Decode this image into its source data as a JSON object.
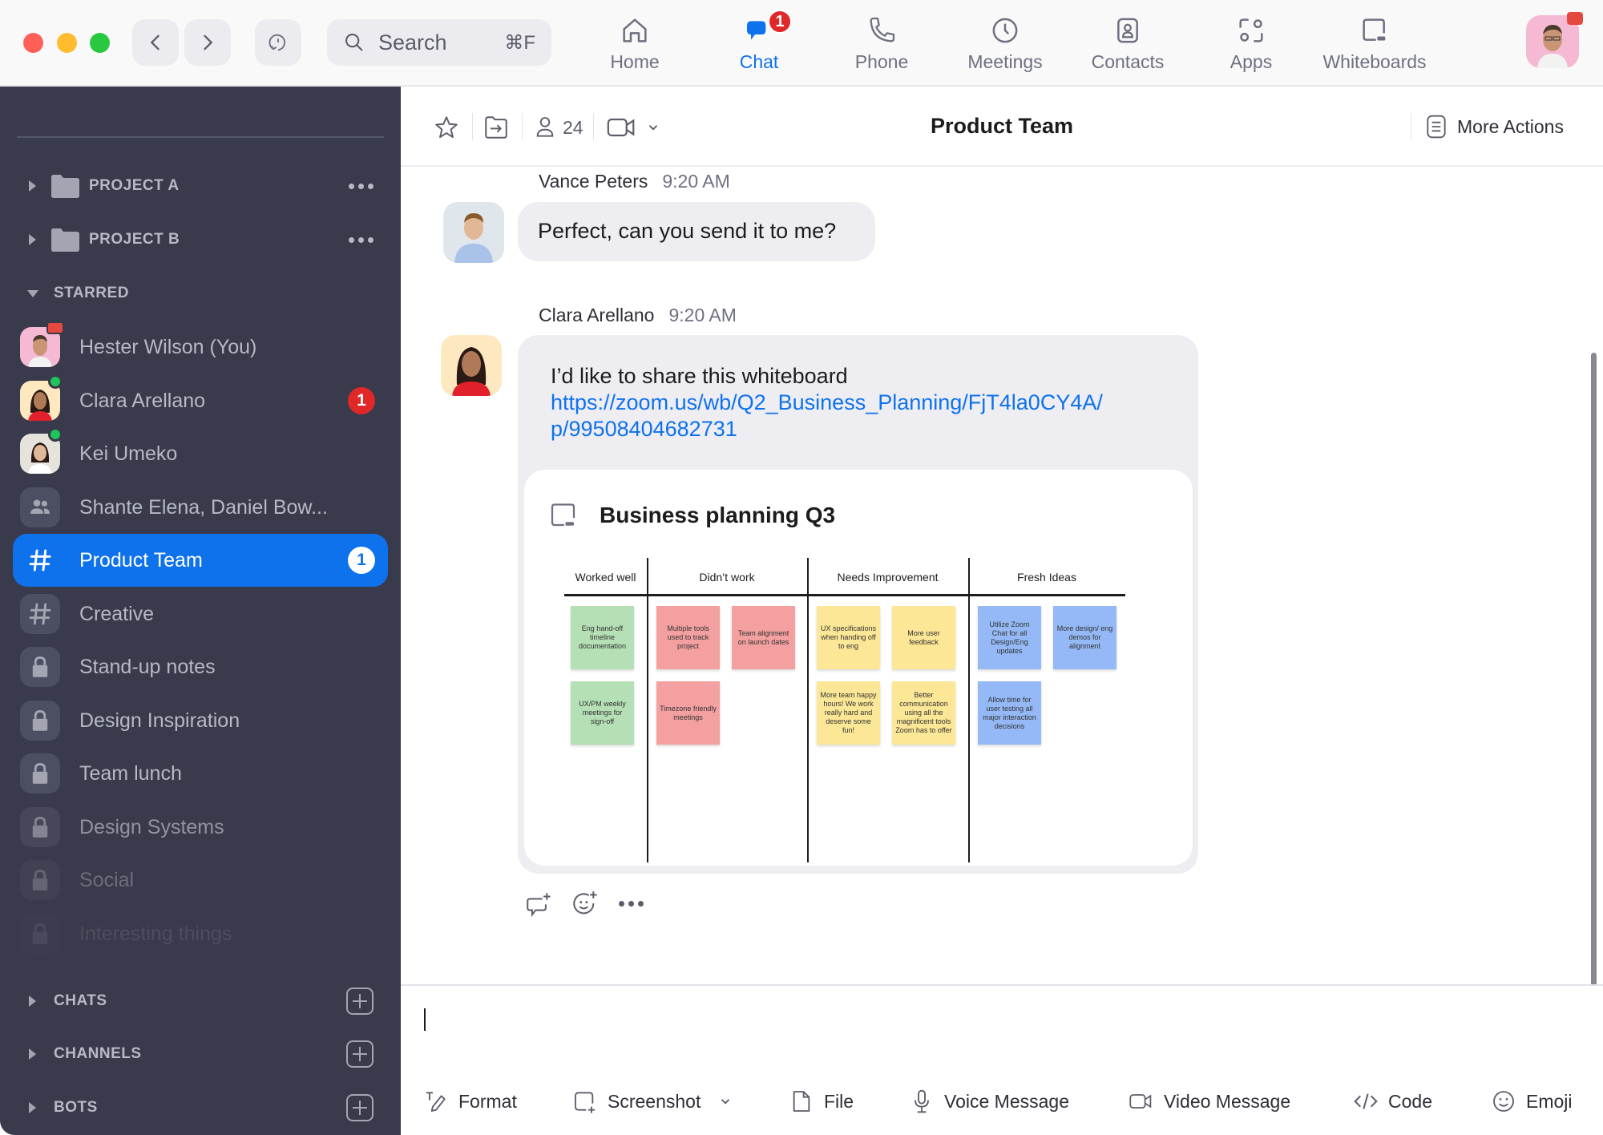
{
  "titlebar": {
    "search_label": "Search",
    "search_shortcut": "⌘F",
    "nav": [
      {
        "label": "Home",
        "icon": "home-icon",
        "active": false
      },
      {
        "label": "Chat",
        "icon": "chat-icon",
        "active": true,
        "badge": "1"
      },
      {
        "label": "Phone",
        "icon": "phone-icon",
        "active": false
      },
      {
        "label": "Meetings",
        "icon": "clock-icon",
        "active": false
      },
      {
        "label": "Contacts",
        "icon": "contacts-icon",
        "active": false
      },
      {
        "label": "Apps",
        "icon": "apps-icon",
        "active": false
      },
      {
        "label": "Whiteboards",
        "icon": "whiteboard-icon",
        "active": false
      }
    ]
  },
  "sidebar": {
    "folders": [
      {
        "label": "PROJECT A"
      },
      {
        "label": "PROJECT B"
      }
    ],
    "starred_label": "STARRED",
    "items": [
      {
        "label": "Hester Wilson (You)",
        "type": "avatar",
        "status": "in-meeting"
      },
      {
        "label": "Clara Arellano",
        "type": "avatar",
        "status": "online",
        "badge": "1"
      },
      {
        "label": "Kei Umeko",
        "type": "avatar",
        "status": "online"
      },
      {
        "label": "Shante Elena, Daniel Bow...",
        "type": "group"
      },
      {
        "label": "Product Team",
        "type": "channel",
        "badge": "1",
        "active": true
      },
      {
        "label": "Creative",
        "type": "channel"
      },
      {
        "label": "Stand-up notes",
        "type": "private"
      },
      {
        "label": "Design Inspiration",
        "type": "private"
      },
      {
        "label": "Team lunch",
        "type": "private"
      },
      {
        "label": "Design Systems",
        "type": "private"
      },
      {
        "label": "Social",
        "type": "private"
      },
      {
        "label": "Interesting things",
        "type": "private"
      }
    ],
    "sections": [
      {
        "label": "CHATS"
      },
      {
        "label": "CHANNELS"
      },
      {
        "label": "BOTS"
      }
    ]
  },
  "chat_header": {
    "title": "Product Team",
    "member_count": "24",
    "more_actions_label": "More Actions"
  },
  "messages": [
    {
      "sender": "Vance Peters",
      "time": "9:20 AM",
      "text": "Perfect, can you send it to me?"
    },
    {
      "sender": "Clara Arellano",
      "time": "9:20 AM",
      "text": "I’d like to share this whiteboard",
      "link_line1": "https://zoom.us/wb/Q2_Business_Planning/FjT4la0CY4A/",
      "link_line2": "p/99508404682731",
      "attachment": {
        "title": "Business planning Q3",
        "columns": [
          "Worked well",
          "Didn’t work",
          "Needs Improvement",
          "Fresh Ideas"
        ],
        "stickies": [
          {
            "column": 0,
            "color": "#b5dfb5",
            "text": "Eng hand-off timeline documentation"
          },
          {
            "column": 0,
            "color": "#b5dfb5",
            "text": "UX/PM weekly meetings for sign-off"
          },
          {
            "column": 1,
            "color": "#f5a0a0",
            "text": "Multiple tools used to track project"
          },
          {
            "column": 1,
            "color": "#f5a0a0",
            "text": "Team alignment on launch dates"
          },
          {
            "column": 1,
            "color": "#f5a0a0",
            "text": "Timezone friendly meetings"
          },
          {
            "column": 2,
            "color": "#fbe795",
            "text": "UX specifications when handing off to eng"
          },
          {
            "column": 2,
            "color": "#fbe795",
            "text": "More user feedback"
          },
          {
            "column": 2,
            "color": "#fbe795",
            "text": "More team happy hours! We work really hard and deserve some fun!"
          },
          {
            "column": 2,
            "color": "#fbe795",
            "text": "Better communication using all the magnificent tools Zoom has to offer"
          },
          {
            "column": 3,
            "color": "#94b9f6",
            "text": "Utilize Zoom Chat for all Design/Eng updates"
          },
          {
            "column": 3,
            "color": "#94b9f6",
            "text": "More design/ eng demos for alignment"
          },
          {
            "column": 3,
            "color": "#94b9f6",
            "text": "Allow time for user testing all major interaction decisions"
          }
        ]
      }
    }
  ],
  "composer": {
    "value": "",
    "tools": [
      {
        "label": "Format",
        "icon": "format-icon"
      },
      {
        "label": "Screenshot",
        "icon": "screenshot-icon"
      },
      {
        "label": "File",
        "icon": "file-icon"
      },
      {
        "label": "Voice Message",
        "icon": "microphone-icon"
      },
      {
        "label": "Video Message",
        "icon": "video-icon"
      },
      {
        "label": "Code",
        "icon": "code-icon"
      },
      {
        "label": "Emoji",
        "icon": "emoji-icon"
      }
    ]
  },
  "colors": {
    "accent": "#0e72ed",
    "sidebar_bg": "#393a4c",
    "badge": "#e02828",
    "online": "#1fc45a"
  }
}
